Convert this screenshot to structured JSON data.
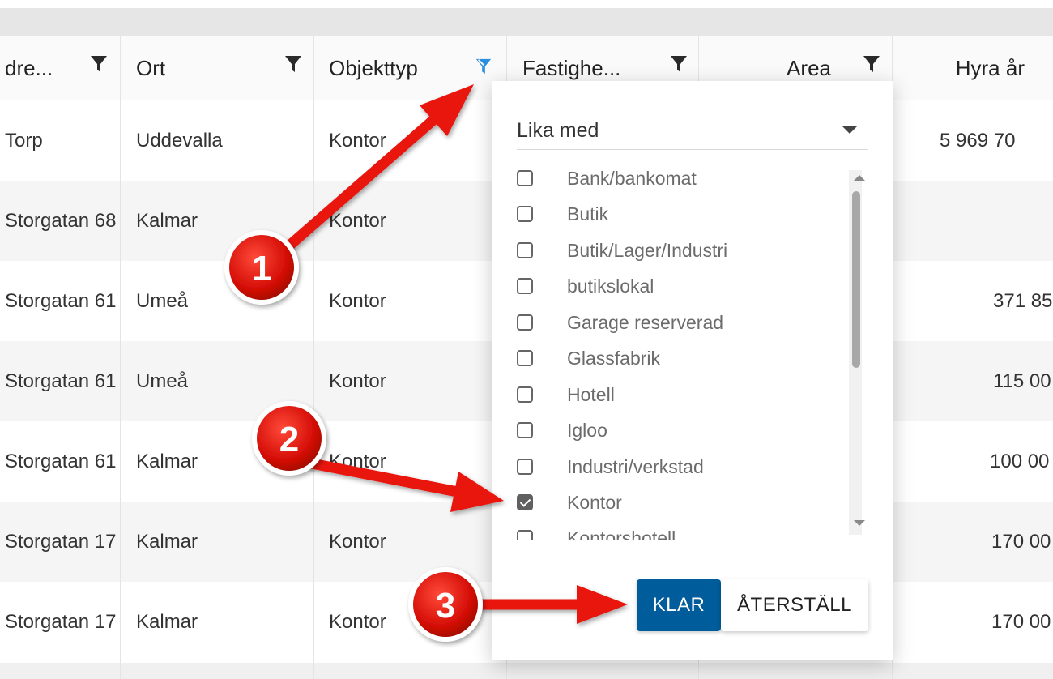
{
  "table": {
    "columns": [
      {
        "label": "dre..."
      },
      {
        "label": "Ort"
      },
      {
        "label": "Objekttyp"
      },
      {
        "label": "Fastighe..."
      },
      {
        "label": "Area"
      },
      {
        "label": "Hyra år"
      }
    ],
    "rows": [
      {
        "adress": "Torp",
        "ort": "Uddevalla",
        "objekttyp": "Kontor",
        "hyra": "5 969 70"
      },
      {
        "adress": "Storgatan 68",
        "ort": "Kalmar",
        "objekttyp": "Kontor",
        "hyra": ""
      },
      {
        "adress": "Storgatan 61",
        "ort": "Umeå",
        "objekttyp": "Kontor",
        "hyra": "371 85"
      },
      {
        "adress": "Storgatan 61",
        "ort": "Umeå",
        "objekttyp": "Kontor",
        "hyra": "115 00"
      },
      {
        "adress": "Storgatan 61",
        "ort": "Kalmar",
        "objekttyp": "Kontor",
        "hyra": "100 00"
      },
      {
        "adress": "Storgatan 17",
        "ort": "Kalmar",
        "objekttyp": "Kontor",
        "hyra": "170 00"
      },
      {
        "adress": "Storgatan 17",
        "ort": "Kalmar",
        "objekttyp": "Kontor",
        "hyra": "170 00"
      }
    ]
  },
  "filter_popup": {
    "operator": "Lika med",
    "options": [
      {
        "label": "Bank/bankomat",
        "checked": false
      },
      {
        "label": "Butik",
        "checked": false
      },
      {
        "label": "Butik/Lager/Industri",
        "checked": false
      },
      {
        "label": "butikslokal",
        "checked": false
      },
      {
        "label": "Garage reserverad",
        "checked": false
      },
      {
        "label": "Glassfabrik",
        "checked": false
      },
      {
        "label": "Hotell",
        "checked": false
      },
      {
        "label": "Igloo",
        "checked": false
      },
      {
        "label": "Industri/verkstad",
        "checked": false
      },
      {
        "label": "Kontor",
        "checked": true
      },
      {
        "label": "Kontorshotell",
        "checked": false
      }
    ],
    "apply_label": "KLAR",
    "reset_label": "ÅTERSTÄLL"
  },
  "annotations": {
    "badges": [
      "1",
      "2",
      "3"
    ]
  },
  "colors": {
    "active_filter": "#2b8fe0",
    "primary_button": "#005c9a",
    "arrow": "#e8120c"
  }
}
